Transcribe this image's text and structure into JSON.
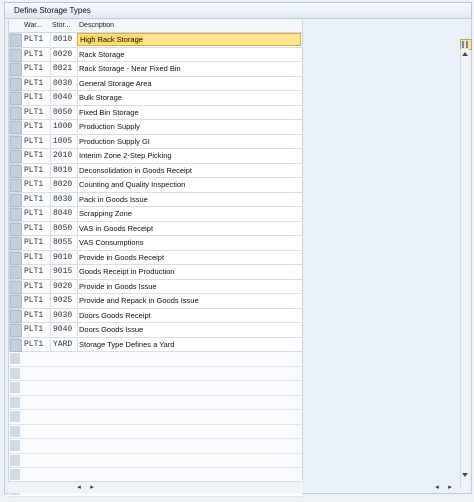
{
  "window": {
    "title": "Define Storage Types"
  },
  "table": {
    "columns": [
      "War...",
      "Stor...",
      "Description"
    ],
    "rows": [
      {
        "warehouse": "PLT1",
        "storage": "0010",
        "description": "High Rack Storage",
        "selected": true
      },
      {
        "warehouse": "PLT1",
        "storage": "0020",
        "description": "Rack Storage"
      },
      {
        "warehouse": "PLT1",
        "storage": "0021",
        "description": "Rack Storage - Near Fixed Bin"
      },
      {
        "warehouse": "PLT1",
        "storage": "0030",
        "description": "General Storage Area"
      },
      {
        "warehouse": "PLT1",
        "storage": "0040",
        "description": "Bulk Storage"
      },
      {
        "warehouse": "PLT1",
        "storage": "0050",
        "description": "Fixed Bin Storage"
      },
      {
        "warehouse": "PLT1",
        "storage": "1000",
        "description": "Production Supply"
      },
      {
        "warehouse": "PLT1",
        "storage": "1005",
        "description": "Production Supply GI"
      },
      {
        "warehouse": "PLT1",
        "storage": "2010",
        "description": "Interim Zone 2-Step Picking"
      },
      {
        "warehouse": "PLT1",
        "storage": "8010",
        "description": "Deconsolidation in Goods Receipt"
      },
      {
        "warehouse": "PLT1",
        "storage": "8020",
        "description": "Counting and Quality Inspection"
      },
      {
        "warehouse": "PLT1",
        "storage": "8030",
        "description": "Pack in Goods Issue"
      },
      {
        "warehouse": "PLT1",
        "storage": "8040",
        "description": "Scrapping Zone"
      },
      {
        "warehouse": "PLT1",
        "storage": "8050",
        "description": "VAS in Goods Receipt"
      },
      {
        "warehouse": "PLT1",
        "storage": "8055",
        "description": "VAS Consumptions"
      },
      {
        "warehouse": "PLT1",
        "storage": "9010",
        "description": "Provide in Goods Receipt"
      },
      {
        "warehouse": "PLT1",
        "storage": "9015",
        "description": "Goods Receipt in Production"
      },
      {
        "warehouse": "PLT1",
        "storage": "9020",
        "description": "Provide in Goods Issue"
      },
      {
        "warehouse": "PLT1",
        "storage": "9025",
        "description": "Provide and Repack in Goods Issue"
      },
      {
        "warehouse": "PLT1",
        "storage": "9030",
        "description": "Doors Goods Receipt"
      },
      {
        "warehouse": "PLT1",
        "storage": "9040",
        "description": "Doors Goods Issue"
      },
      {
        "warehouse": "PLT1",
        "storage": "YARD",
        "description": "Storage Type Defines a Yard"
      }
    ],
    "empty_row_count": 10
  },
  "scroll": {
    "left_arrow": "◂",
    "right_arrow": "▸"
  },
  "colors": {
    "highlight": "#ffe58f",
    "header": "#f3f7fb",
    "selector": "#c3cfdb"
  }
}
